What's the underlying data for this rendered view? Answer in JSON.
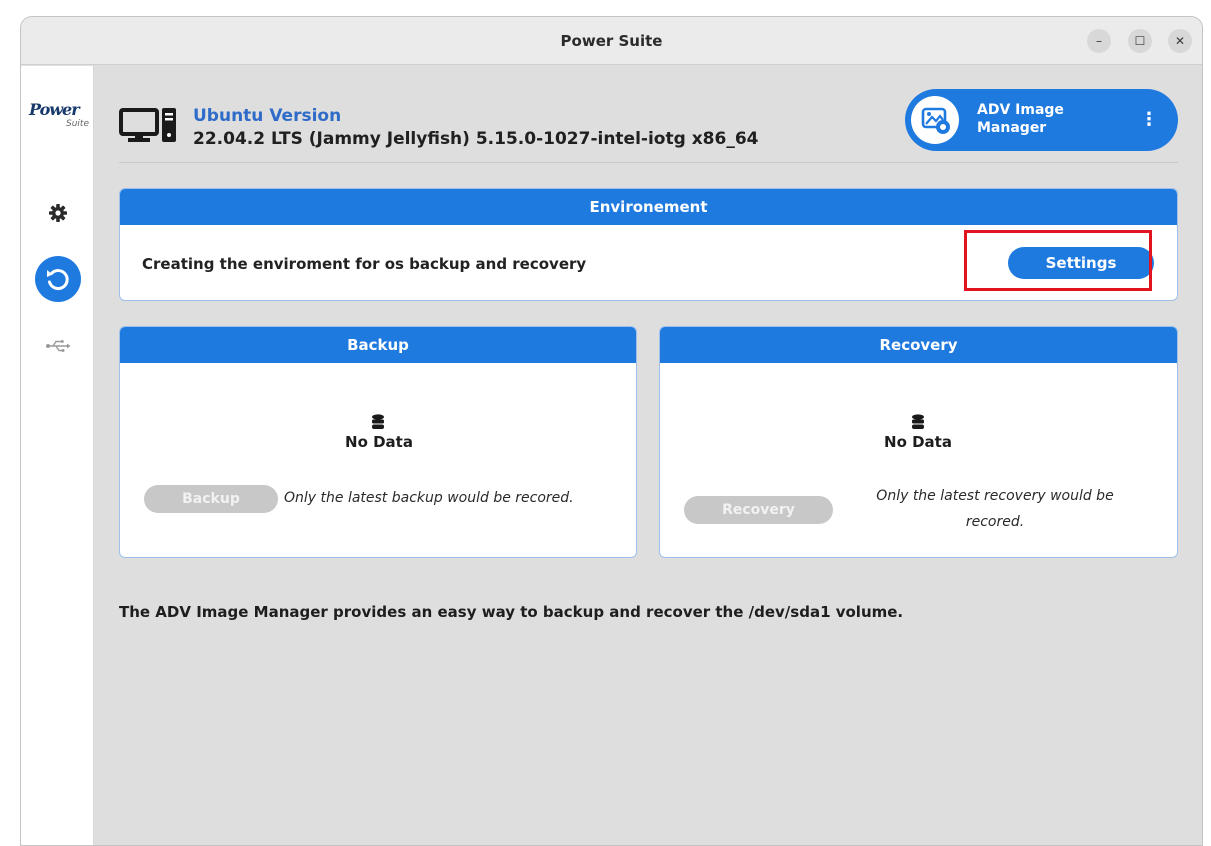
{
  "window": {
    "title": "Power Suite",
    "controls": {
      "minimize": "–",
      "maximize": "☐",
      "close": "✕"
    }
  },
  "sidebar": {
    "logo_main": "Power",
    "logo_sub": "Suite",
    "items": [
      {
        "name": "settings",
        "icon": "gear-icon"
      },
      {
        "name": "backup-recovery",
        "icon": "restore-icon",
        "active": true
      },
      {
        "name": "usb",
        "icon": "usb-icon"
      }
    ]
  },
  "os": {
    "label": "Ubuntu Version",
    "version": "22.04.2 LTS (Jammy Jellyfish) 5.15.0-1027-intel-iotg x86_64"
  },
  "adv": {
    "label": "ADV Image Manager",
    "more": "⋮"
  },
  "environment": {
    "title": "Environement",
    "description": "Creating the enviroment for os backup and recovery",
    "settings_label": "Settings"
  },
  "backup": {
    "title": "Backup",
    "no_data": "No Data",
    "button_label": "Backup",
    "note": "Only the latest backup would be recored."
  },
  "recovery": {
    "title": "Recovery",
    "no_data": "No Data",
    "button_label": "Recovery",
    "note": "Only the latest recovery would be recored."
  },
  "footer": "The ADV Image Manager provides an easy way to backup and recover the /dev/sda1 volume.",
  "colors": {
    "accent": "#1f7ae0",
    "highlight": "#e0131f",
    "disabled": "#c8c8c8"
  }
}
